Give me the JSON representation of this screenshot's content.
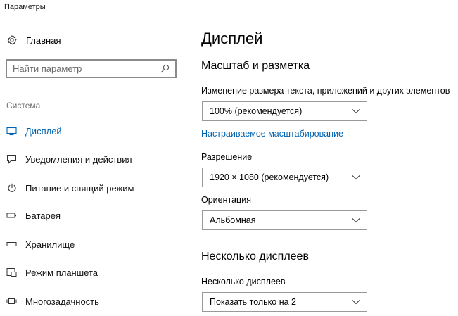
{
  "window": {
    "title": "Параметры"
  },
  "sidebar": {
    "home_label": "Главная",
    "search_placeholder": "Найти параметр",
    "section_label": "Система",
    "items": [
      {
        "label": "Дисплей",
        "icon": "monitor-icon",
        "active": true
      },
      {
        "label": "Уведомления и действия",
        "icon": "notifications-icon",
        "active": false
      },
      {
        "label": "Питание и спящий режим",
        "icon": "power-icon",
        "active": false
      },
      {
        "label": "Батарея",
        "icon": "battery-icon",
        "active": false
      },
      {
        "label": "Хранилище",
        "icon": "storage-icon",
        "active": false
      },
      {
        "label": "Режим планшета",
        "icon": "tablet-mode-icon",
        "active": false
      },
      {
        "label": "Многозадачность",
        "icon": "multitasking-icon",
        "active": false
      }
    ]
  },
  "main": {
    "title": "Дисплей",
    "scale_section": {
      "heading": "Масштаб и разметка",
      "size_label": "Изменение размера текста, приложений и других элементов",
      "size_value": "100% (рекомендуется)",
      "custom_scaling_link": "Настраиваемое масштабирование",
      "resolution_label": "Разрешение",
      "resolution_value": "1920 × 1080 (рекомендуется)",
      "orientation_label": "Ориентация",
      "orientation_value": "Альбомная"
    },
    "multi_section": {
      "heading": "Несколько дисплеев",
      "label": "Несколько дисплеев",
      "value": "Показать только на 2"
    }
  },
  "colors": {
    "accent": "#0063b1",
    "text": "#000000",
    "muted": "#6d6d6d",
    "border": "#999999"
  }
}
